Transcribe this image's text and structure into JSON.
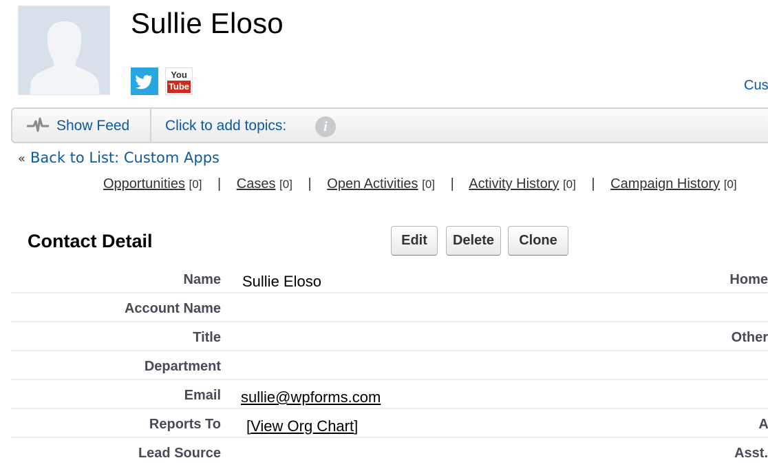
{
  "record": {
    "name": "Sullie Eloso",
    "avatar_icon": "person-silhouette-icon",
    "social": [
      {
        "name": "Twitter",
        "icon": "twitter-icon",
        "color": "#27a6e1"
      },
      {
        "name": "YouTube",
        "icon": "youtube-icon",
        "top_text": "You",
        "bottom_text": "Tube",
        "color": "#d02a1f"
      }
    ],
    "custom_link_partial": "Cus"
  },
  "feed_bar": {
    "show_feed_label": "Show Feed",
    "feed_icon": "pulse-icon",
    "topics_label": "Click to add topics:",
    "info_icon": "info-icon",
    "info_glyph": "i"
  },
  "back_link": {
    "prefix": "«",
    "label": "Back to List: Custom Apps"
  },
  "related_lists": [
    {
      "label": "Opportunities",
      "count": "[0]"
    },
    {
      "label": "Cases",
      "count": "[0]"
    },
    {
      "label": "Open Activities",
      "count": "[0]"
    },
    {
      "label": "Activity History",
      "count": "[0]"
    },
    {
      "label": "Campaign History",
      "count": "[0]"
    }
  ],
  "related_separator": "|",
  "detail": {
    "title": "Contact Detail",
    "buttons": {
      "edit": "Edit",
      "delete": "Delete",
      "clone": "Clone"
    },
    "rows": [
      {
        "label": "Name",
        "value": "Sullie Eloso",
        "right_label": "Home"
      },
      {
        "label": "Account Name",
        "value": "",
        "right_label": ""
      },
      {
        "label": "Title",
        "value": "",
        "right_label": "Other"
      },
      {
        "label": "Department",
        "value": "",
        "right_label": ""
      },
      {
        "label": "Email",
        "value": "sullie@wpforms.com",
        "right_label": ""
      },
      {
        "label": "Reports To",
        "value_prefix": "[",
        "value": "View Org Chart",
        "value_suffix": "]",
        "right_label": "As"
      },
      {
        "label": "Lead Source",
        "value": "",
        "right_label": "Asst."
      }
    ]
  },
  "colors": {
    "link": "#0b5aa2",
    "label": "#4a4a56",
    "avatar_bg": "#d8e1e9"
  }
}
